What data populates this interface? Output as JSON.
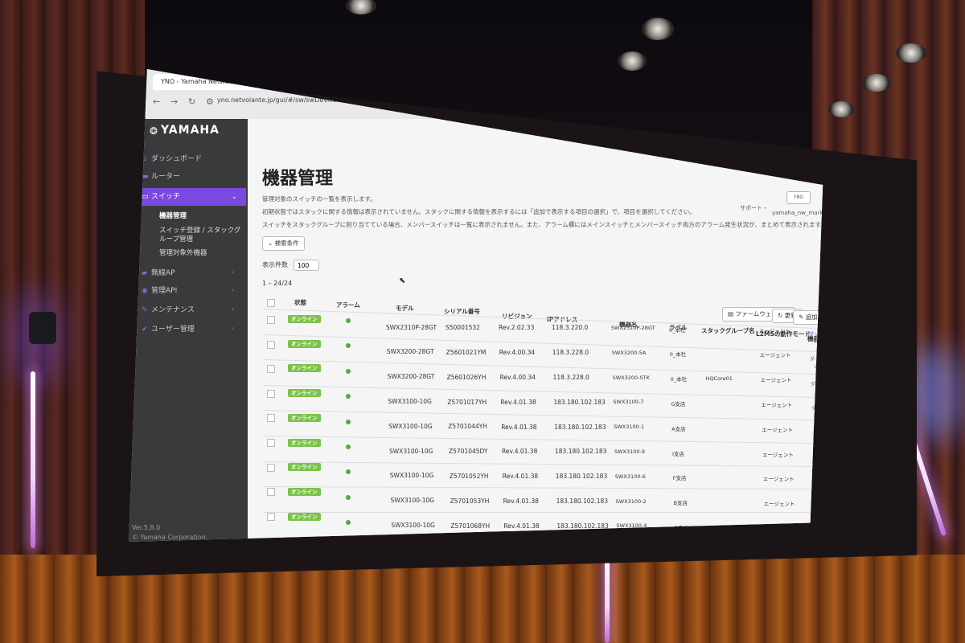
{
  "browser": {
    "tab_title": "YNO - Yamaha Network Orga",
    "new_tab": "+",
    "url": "yno.netvolante.jp/gui/#/sw/swDeviceManagement"
  },
  "sidebar": {
    "brand": "YAMAHA",
    "items": [
      {
        "label": "ダッシュボード"
      },
      {
        "label": "ルーター"
      },
      {
        "label": "スイッチ"
      },
      {
        "label": "無線AP"
      },
      {
        "label": "管理API"
      },
      {
        "label": "メンテナンス"
      },
      {
        "label": "ユーザー管理"
      }
    ],
    "sub_items": [
      {
        "label": "機器管理"
      },
      {
        "label": "スイッチ登録 / スタックグ"
      },
      {
        "label": "ループ管理"
      },
      {
        "label": "管理対象外機器"
      }
    ],
    "version": "Ver.5.8.0",
    "copyright": "© Yamaha Corporation."
  },
  "header": {
    "support": "サポート・",
    "user": "yamaha_nw_marketing・",
    "ext_icon": "Y8G"
  },
  "page": {
    "title": "機器管理",
    "desc1": "管理対象のスイッチの一覧を表示します。",
    "desc2": "初期状態ではスタックに関する情報は表示されていません。スタックに関する情報を表示するには「追加で表示する項目の選択」で、項目を選択してください。",
    "desc3": "スイッチをスタックグループに割り当てている場合、メンバースイッチは一覧に表示されません。また、アラーム欄にはメインスイッチとメンバースイッチ両方のアラーム発生状況が、まとめて表示されます。",
    "search_btn": "検索条件",
    "display_count_label": "表示件数",
    "display_count_value": "100",
    "count_text": "1 – 24/24",
    "firmware_btn": "ファームウェア更新",
    "refresh_btn": "更新",
    "add_cols_btn": "追加で表示する項目の選択"
  },
  "table": {
    "headers": [
      "状態",
      "アラーム",
      "モデル",
      "シリアル番号",
      "リビジョン",
      "IPアドレス",
      "機器名",
      "ラベル",
      "スタックグループ名",
      "L2MSの動作モード",
      "機器の...に"
    ],
    "link1": "ダッシュボードを表示",
    "link2": "L2MSマップを表示",
    "rows": [
      {
        "status": "オンライン",
        "model": "SWX2310P-28GT",
        "serial": "S50001532",
        "rev": "Rev.2.02.33",
        "ip": "118.3.220.0",
        "name": "SWX2310P-28GT",
        "label": "0_本社",
        "stack": "",
        "mode": "エージェント"
      },
      {
        "status": "オンライン",
        "model": "SWX3200-28GT",
        "serial": "Z5601021YM",
        "rev": "Rev.4.00.34",
        "ip": "118.3.228.0",
        "name": "SWX3200-5A",
        "label": "0_本社",
        "stack": "",
        "mode": "エージェント"
      },
      {
        "status": "オンライン",
        "model": "SWX3200-28GT",
        "serial": "Z5601026YH",
        "rev": "Rev.4.00.34",
        "ip": "118.3.228.0",
        "name": "SWX3200-STK",
        "label": "0_本社",
        "stack": "HQCore01",
        "mode": "エージェント"
      },
      {
        "status": "オンライン",
        "model": "SWX3100-10G",
        "serial": "Z5701017YH",
        "rev": "Rev.4.01.38",
        "ip": "183.180.102.183",
        "name": "SWX3100-7",
        "label": "G支店",
        "stack": "",
        "mode": "エージェント"
      },
      {
        "status": "オンライン",
        "model": "SWX3100-10G",
        "serial": "Z5701044YH",
        "rev": "Rev.4.01.38",
        "ip": "183.180.102.183",
        "name": "SWX3100-1",
        "label": "A支店",
        "stack": "",
        "mode": "エージェント"
      },
      {
        "status": "オンライン",
        "model": "SWX3100-10G",
        "serial": "Z5701045DY",
        "rev": "Rev.4.01.38",
        "ip": "183.180.102.183",
        "name": "SWX3100-9",
        "label": "I支店",
        "stack": "",
        "mode": "エージェント"
      },
      {
        "status": "オンライン",
        "model": "SWX3100-10G",
        "serial": "Z5701052YH",
        "rev": "Rev.4.01.38",
        "ip": "183.180.102.183",
        "name": "SWX3100-6",
        "label": "F支店",
        "stack": "",
        "mode": "エージェント"
      },
      {
        "status": "オンライン",
        "model": "SWX3100-10G",
        "serial": "Z5701053YH",
        "rev": "Rev.4.01.38",
        "ip": "183.180.102.183",
        "name": "SWX3100-2",
        "label": "B支店",
        "stack": "",
        "mode": "エージェント"
      },
      {
        "status": "オンライン",
        "model": "SWX3100-10G",
        "serial": "Z5701068YH",
        "rev": "Rev.4.01.38",
        "ip": "183.180.102.183",
        "name": "SWX3100-4",
        "label": "D支店",
        "stack": "",
        "mode": "エージェント"
      }
    ]
  },
  "colors": {
    "accent": "#7a4ae0",
    "online": "#7cc24a",
    "sidebar": "#3a3a3d"
  }
}
